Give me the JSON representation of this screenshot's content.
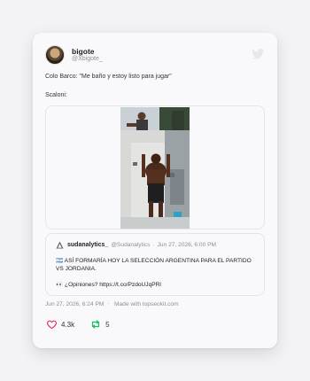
{
  "author": {
    "display_name": "bigote",
    "handle": "@Xbigote_"
  },
  "tweet": {
    "line1": "Colo Barco: \"Me baño y estoy listo para jugar\"",
    "line2": "Scaloni:"
  },
  "quoted_tweet": {
    "display_name": "sudanalytics_",
    "handle": "@Sudanalytics",
    "separator": "·",
    "date": "Jun 27, 2026, 6:00 PM",
    "body_line1": "🇦🇷 ASÍ FORMARÍA HOY LA SELECCIÓN ARGENTINA PARA EL PARTIDO VS JORDANIA.",
    "body_line2": "👀 ¿Opiniones? https://t.co/PzdoUJqPRl"
  },
  "footer": {
    "date": "Jun 27, 2026, 6:24 PM",
    "separator": "·",
    "made_with": "Made with topseokit.com"
  },
  "stats": {
    "likes": "4.3k",
    "retweets": "5"
  },
  "colors": {
    "background": "#f3f3f6",
    "card": "#f9f9fb",
    "twitter_icon": "#e6e8ee",
    "like_icon": "#e0245e",
    "retweet_icon": "#17bf63",
    "muted_text": "#8a8f99"
  },
  "icons": {
    "brand": "twitter-bird-icon",
    "like": "heart-icon",
    "retweet": "retweet-icon",
    "quoted_avatar": "sudanalytics-logo-icon"
  }
}
